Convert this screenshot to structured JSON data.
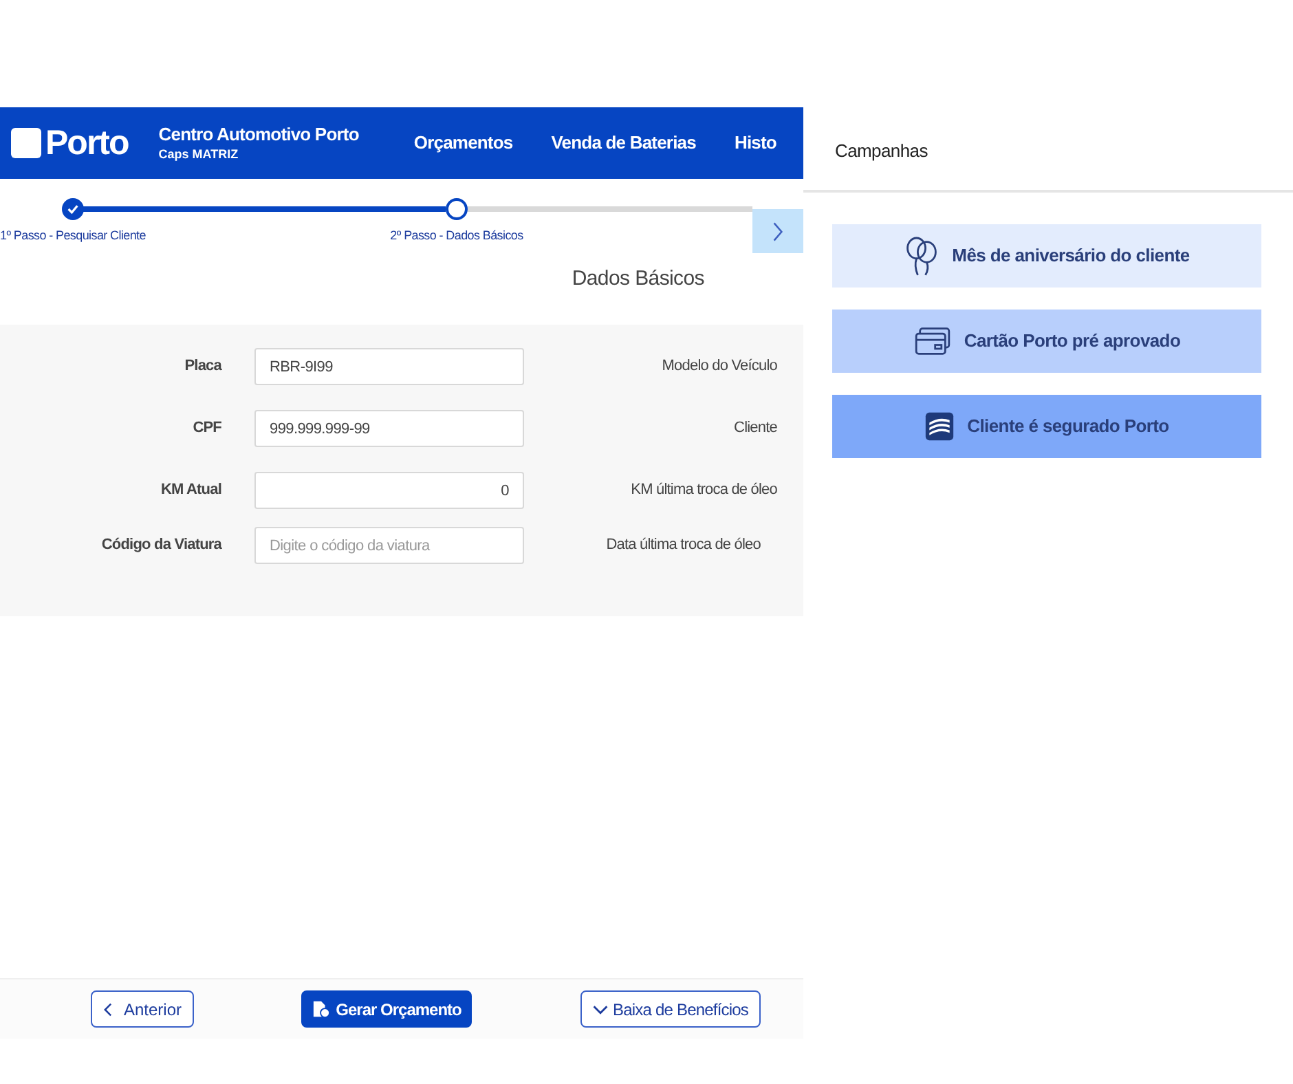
{
  "header": {
    "logo": "Porto",
    "title": "Centro Automotivo Porto",
    "subtitle": "Caps MATRIZ",
    "nav": [
      {
        "label": "Orçamentos"
      },
      {
        "label": "Venda de Baterias"
      },
      {
        "label": "Histo"
      }
    ]
  },
  "stepper": {
    "steps": [
      {
        "label": "1º Passo - Pesquisar Cliente",
        "done": true
      },
      {
        "label": "2º Passo - Dados Básicos",
        "done": false
      }
    ]
  },
  "section_title": "Dados Básicos",
  "form": {
    "rows": [
      {
        "label": "Placa",
        "value": "RBR-9I99",
        "kind": "text",
        "info_label": "Modelo do Veículo"
      },
      {
        "label": "CPF",
        "value": "999.999.999-99",
        "kind": "text",
        "info_label": "Cliente"
      },
      {
        "label": "KM Atual",
        "value": "0",
        "kind": "number",
        "info_label": "KM última troca de óleo"
      },
      {
        "label": "Código da Viatura",
        "placeholder": "Digite o código da viatura",
        "kind": "text",
        "info_label": "Data última troca de óleo"
      }
    ]
  },
  "footer": {
    "buttons": [
      {
        "label": "Anterior",
        "kind": "back"
      },
      {
        "label": "Gerar Orçamento",
        "kind": "primary"
      },
      {
        "label": "Baixa de Benefícios",
        "kind": "dropdown"
      }
    ]
  },
  "campaigns": {
    "title": "Campanhas",
    "items": [
      {
        "label": "Mês de aniversário do cliente",
        "kind": "balloons",
        "color": "#e3ecfd"
      },
      {
        "label": "Cartão Porto pré aprovado",
        "kind": "card",
        "color": "#b8cffc"
      },
      {
        "label": "Cliente é segurado Porto",
        "kind": "logo",
        "color": "#7ea8f9"
      }
    ]
  }
}
